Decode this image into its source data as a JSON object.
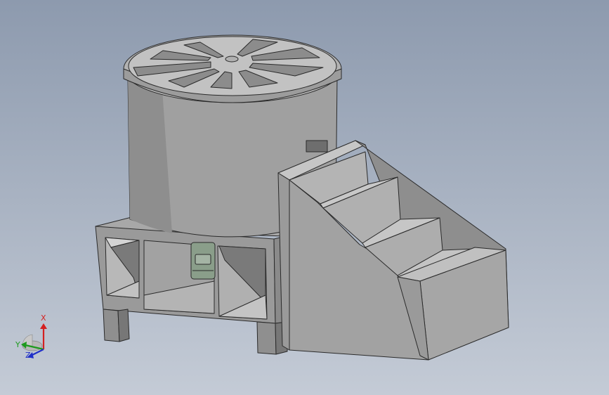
{
  "viewport": {
    "background_top": "#8d9aae",
    "background_bottom": "#c4cbd6"
  },
  "model": {
    "body_color": "#9c9c9c",
    "shadow_color": "#6f6f6f",
    "edge_color": "#2a2a2a",
    "motor_color": "#8a9e8a"
  },
  "triad": {
    "x_label": "X",
    "y_label": "Y",
    "z_label": "Z",
    "x_color": "#d42020",
    "y_color": "#1e9a1e",
    "z_color": "#2030c8"
  }
}
